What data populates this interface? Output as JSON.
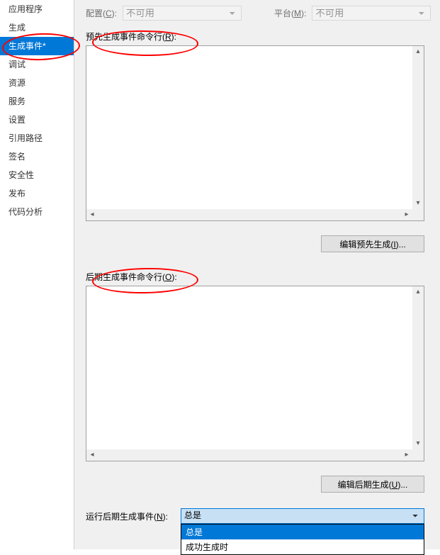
{
  "sidebar": {
    "items": [
      {
        "label": "应用程序"
      },
      {
        "label": "生成"
      },
      {
        "label": "生成事件*",
        "selected": true
      },
      {
        "label": "调试"
      },
      {
        "label": "资源"
      },
      {
        "label": "服务"
      },
      {
        "label": "设置"
      },
      {
        "label": "引用路径"
      },
      {
        "label": "签名"
      },
      {
        "label": "安全性"
      },
      {
        "label": "发布"
      },
      {
        "label": "代码分析"
      }
    ]
  },
  "top": {
    "config_label_pre": "配置(",
    "config_label_u": "C",
    "config_label_post": "):",
    "config_value": "不可用",
    "platform_label_pre": "平台(",
    "platform_label_u": "M",
    "platform_label_post": "):",
    "platform_value": "不可用"
  },
  "prebuild": {
    "label_pre": "预先生成事件命令行(",
    "label_u": "R",
    "label_post": "):",
    "value": "",
    "button_pre": "编辑预先生成(",
    "button_u": "I",
    "button_post": ")..."
  },
  "postbuild": {
    "label_pre": "后期生成事件命令行(",
    "label_u": "O",
    "label_post": "):",
    "value": "",
    "button_pre": "编辑后期生成(",
    "button_u": "U",
    "button_post": ")..."
  },
  "run": {
    "label_pre": "运行后期生成事件(",
    "label_u": "N",
    "label_post": "):",
    "selected": "总是",
    "options": [
      "总是",
      "成功生成时"
    ]
  }
}
